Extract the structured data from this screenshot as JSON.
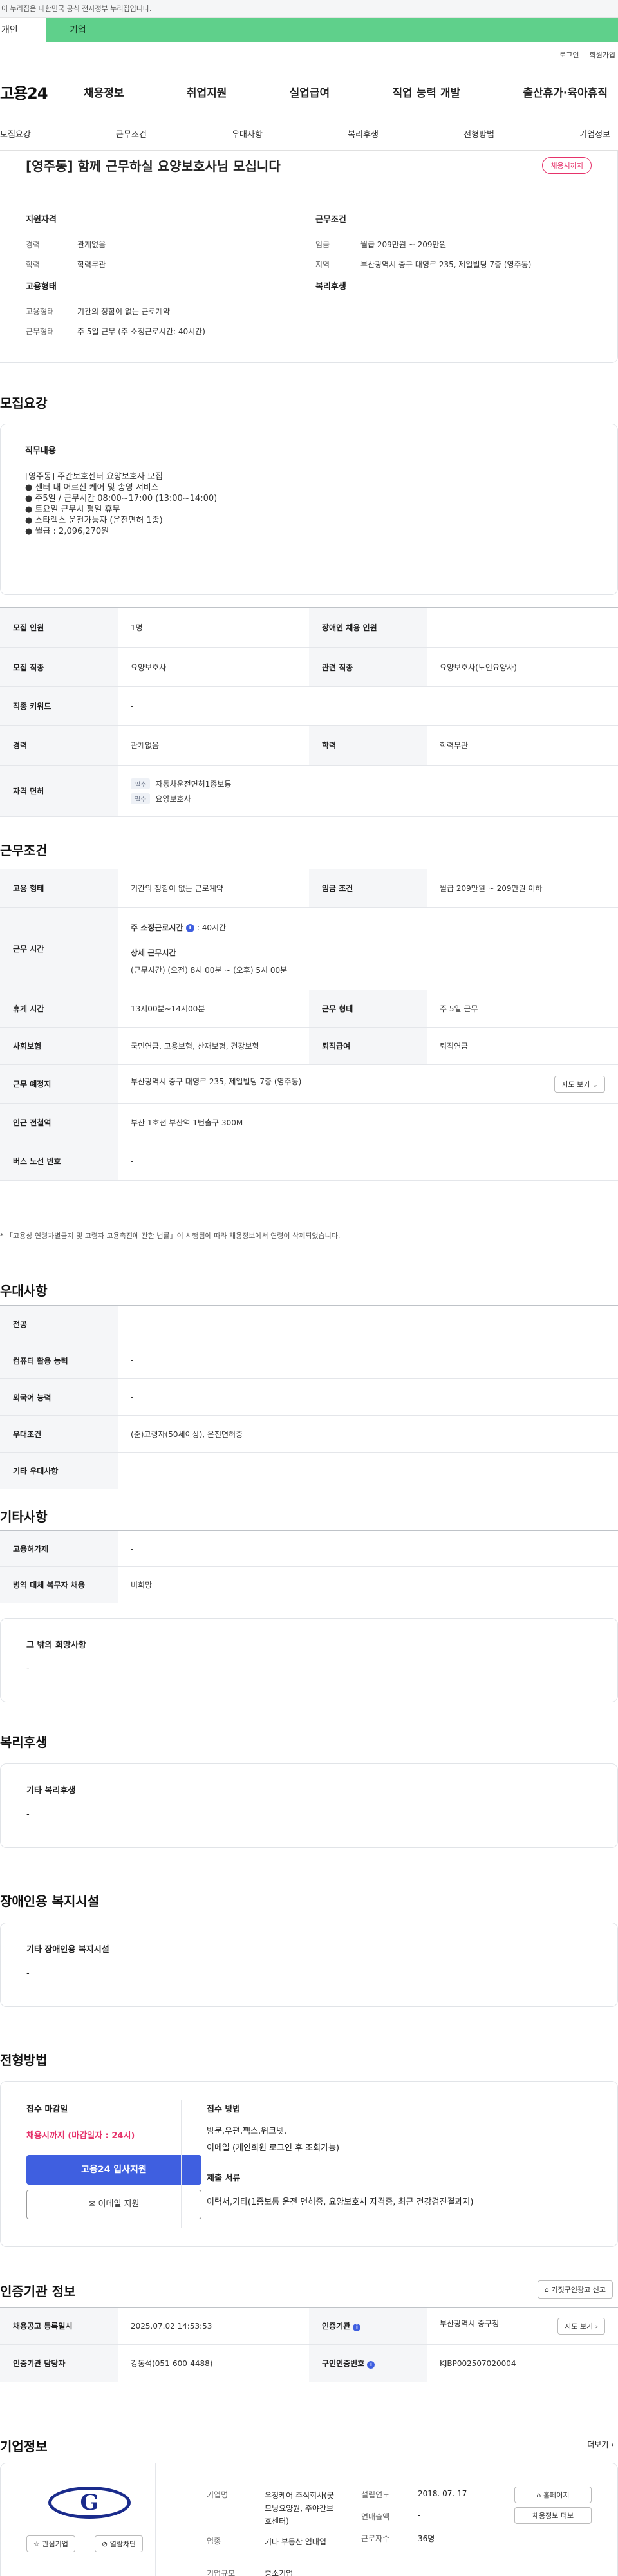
{
  "gov_banner": "이 누리집은 대한민국 공식 전자정부 누리집입니다.",
  "type_tabs": [
    "개인",
    "기업"
  ],
  "util": [
    "로그인",
    "회원가입"
  ],
  "logo": "고용24",
  "gnb": [
    "채용정보",
    "취업지원",
    "실업급여",
    "직업 능력 개발",
    "출산휴가·육아휴직"
  ],
  "anchor_nav": [
    "모집요강",
    "근무조건",
    "우대사항",
    "복리후생",
    "전형방법",
    "기업정보"
  ],
  "summary": {
    "title": "[영주동] 함께 근무하실 요양보호사님 모십니다",
    "status": "채용시까지",
    "qualification": {
      "head": "지원자격",
      "rows": [
        [
          "경력",
          "관계없음"
        ],
        [
          "학력",
          "학력무관"
        ]
      ]
    },
    "conditions": {
      "head": "근무조건",
      "rows": [
        [
          "임금",
          "월급 209만원 ~ 209만원"
        ],
        [
          "지역",
          "부산광역시 중구 대영로 235, 제일빌딩 7층 (영주동)"
        ]
      ]
    },
    "employment": {
      "head": "고용형태",
      "rows": [
        [
          "고용형태",
          "기간의 정함이 없는 근로계약"
        ],
        [
          "근무형태",
          "주 5일 근무 (주 소정근로시간: 40시간)"
        ]
      ]
    },
    "welfare_head": "복리후생"
  },
  "recruit": {
    "title": "모집요강",
    "duty_head": "직무내용",
    "duty_lines": [
      "[영주동] 주간보호센터 요양보호사 모집",
      "● 센터 내 어르신 케어 및  송영 서비스",
      "● 주5일 / 근무시간 08:00~17:00 (13:00~14:00)",
      "● 토요일 근무시 평일 휴무",
      "● 스타렉스 운전가능자 (운전면허 1종)",
      "● 월급 : 2,096,270원"
    ],
    "rows": [
      [
        "모집 인원",
        "1명",
        "장애인 채용 인원",
        "-"
      ],
      [
        "모집 직종",
        "요양보호사",
        "관련 직종",
        "요양보호사(노인요양사)"
      ],
      [
        "직종 키워드",
        "-"
      ],
      [
        "경력",
        "관계없음",
        "학력",
        "학력무관"
      ]
    ],
    "license_label": "자격 면허",
    "licenses": [
      [
        "필수",
        "자동차운전면허1종보통"
      ],
      [
        "필수",
        "요양보호사"
      ]
    ]
  },
  "work": {
    "title": "근무조건",
    "r1": [
      "고용 형태",
      "기간의 정함이 없는 근로계약",
      "임금 조건",
      "월급 209만원 ~ 209만원 이하"
    ],
    "time_label": "근무 시간",
    "time_main": "주 소정근로시간",
    "time_main_value": ": 40시간",
    "time_detail_head": "상세 근무시간",
    "time_detail": "(근무시간) (오전) 8시 00분 ~ (오후) 5시 00분",
    "r3": [
      "휴게 시간",
      "13시00분~14시00분",
      "근무 형태",
      "주 5일 근무"
    ],
    "r4": [
      "사회보험",
      "국민연금, 고용보험, 산재보험, 건강보험",
      "퇴직급여",
      "퇴직연금"
    ],
    "place_label": "근무 예정지",
    "place": "부산광역시 중구 대영로 235, 제일빌딩 7층 (영주동)",
    "map_btn": "지도 보기",
    "subway_label": "인근 전철역",
    "subway": "부산 1호선 부산역 1번출구 300M",
    "bus_label": "버스 노선 번호",
    "bus": "-",
    "note": "「고용상 연령차별금지 및 고령자 고용촉진에 관한 법률」이 시행됨에 따라 채용정보에서 연령이 삭제되었습니다."
  },
  "prefer": {
    "title": "우대사항",
    "rows": [
      [
        "전공",
        "-"
      ],
      [
        "컴퓨터 활용 능력",
        "-"
      ],
      [
        "외국어 능력",
        "-"
      ],
      [
        "우대조건",
        "(준)고령자(50세이상), 운전면허증"
      ],
      [
        "기타 우대사항",
        "-"
      ]
    ]
  },
  "etc": {
    "title": "기타사항",
    "rows": [
      [
        "고용허가제",
        "-"
      ],
      [
        "병역 대체 복무자 채용",
        "비희망"
      ]
    ],
    "other_head": "그 밖의 희망사항",
    "other_value": "-"
  },
  "benefit": {
    "title": "복리후생",
    "head": "기타 복리후생",
    "value": "-"
  },
  "disabled": {
    "title": "장애인용 복지시설",
    "head": "기타 장애인용 복지시설",
    "value": "-"
  },
  "process": {
    "title": "전형방법",
    "deadline_head": "접수 마감일",
    "deadline": "채용시까지 (마감일자 : 24시)",
    "apply_btn": "고용24 입사지원",
    "email_btn": "이메일 지원",
    "method_head": "접수 방법",
    "method_lines": [
      "방문,우편,팩스,워크넷,",
      "이메일 (개인회원 로그인 후 조회가능)"
    ],
    "docs_head": "제출 서류",
    "docs": "이력서,기타(1종보통 운전 면허증, 요양보호사 자격증, 최근 건강검진결과지)"
  },
  "agency": {
    "title": "인증기관 정보",
    "report_btn": "거짓구인광고 신고",
    "rows": [
      [
        "채용공고 등록일시",
        "2025.07.02 14:53:53",
        "인증기관",
        "부산광역시 중구청"
      ],
      [
        "인증기관 담당자",
        "강동석(051-600-4488)",
        "구인인증번호",
        "KJBP002507020004"
      ]
    ],
    "map_btn": "지도 보기"
  },
  "company": {
    "title": "기업정보",
    "more": "더보기",
    "logo_letter": "G",
    "fav_btn": "관심기업",
    "block_btn": "열람차단",
    "name_label": "기업명",
    "name": "우정케어 주식회사(굿모닝요양원, 주야간보호센터)",
    "industry_label": "업종",
    "industry": "기타 부동산 임대업",
    "size_label": "기업규모",
    "size": "중소기업",
    "founded_label": "설립연도",
    "founded": "2018. 07. 17",
    "sales_label": "연매출액",
    "sales": "-",
    "staff_label": "근로자수",
    "staff": "36명",
    "home_btn": "홈페이지",
    "jobs_btn": "채용정보 더보"
  },
  "colors": {
    "accent_green": "#5fd08b",
    "apply_blue": "#3f5fe0",
    "status_red": "#e6336b"
  }
}
